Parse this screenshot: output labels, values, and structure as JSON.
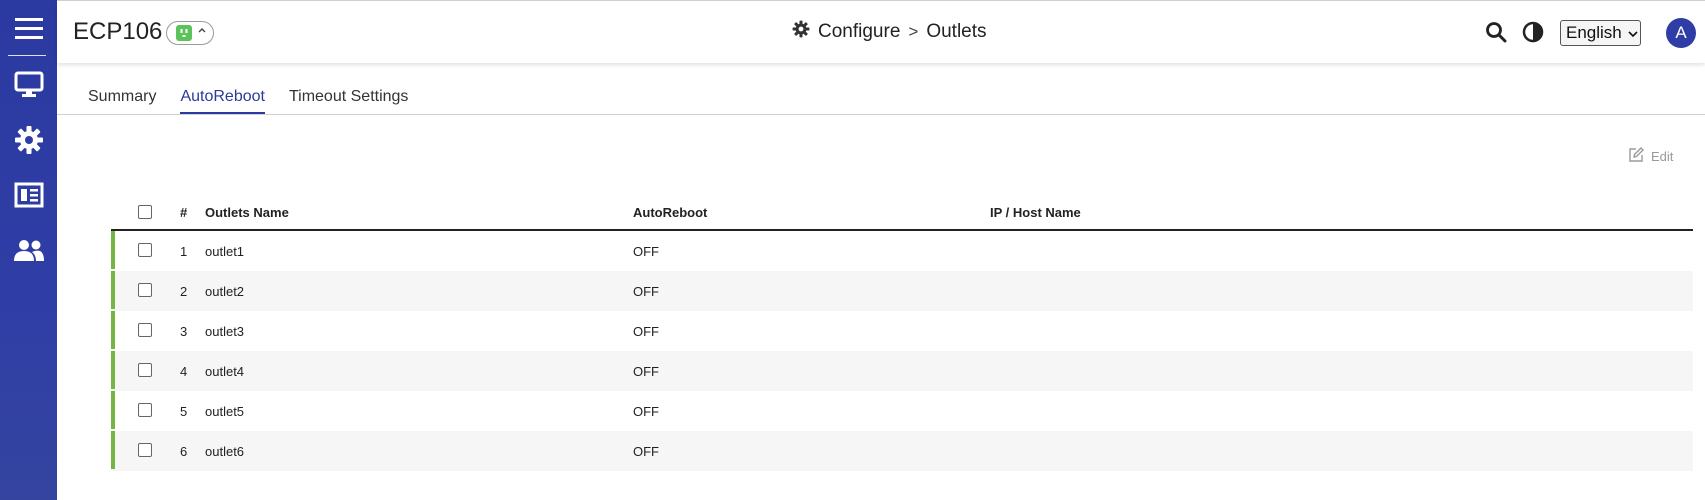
{
  "header": {
    "device_name": "ECP106",
    "breadcrumb": {
      "section": "Configure",
      "separator": ">",
      "page": "Outlets"
    },
    "language": "English",
    "avatar_initial": "A"
  },
  "tabs": [
    {
      "label": "Summary",
      "active": false
    },
    {
      "label": "AutoReboot",
      "active": true
    },
    {
      "label": "Timeout Settings",
      "active": false
    }
  ],
  "toolbar": {
    "edit_label": "Edit"
  },
  "table": {
    "columns": [
      "#",
      "Outlets Name",
      "AutoReboot",
      "IP / Host Name"
    ],
    "rows": [
      {
        "num": "1",
        "name": "outlet1",
        "autoreboot": "OFF",
        "ip": ""
      },
      {
        "num": "2",
        "name": "outlet2",
        "autoreboot": "OFF",
        "ip": ""
      },
      {
        "num": "3",
        "name": "outlet3",
        "autoreboot": "OFF",
        "ip": ""
      },
      {
        "num": "4",
        "name": "outlet4",
        "autoreboot": "OFF",
        "ip": ""
      },
      {
        "num": "5",
        "name": "outlet5",
        "autoreboot": "OFF",
        "ip": ""
      },
      {
        "num": "6",
        "name": "outlet6",
        "autoreboot": "OFF",
        "ip": ""
      }
    ]
  },
  "colors": {
    "sidebar": "#2f3ea6",
    "accent": "#2a3a9e",
    "status_green": "#74b544"
  },
  "icons": {
    "sidebar": [
      "menu-icon",
      "monitor-icon",
      "gear-icon",
      "newspaper-icon",
      "users-icon"
    ],
    "header": [
      "gear-icon",
      "search-icon",
      "contrast-icon"
    ]
  }
}
